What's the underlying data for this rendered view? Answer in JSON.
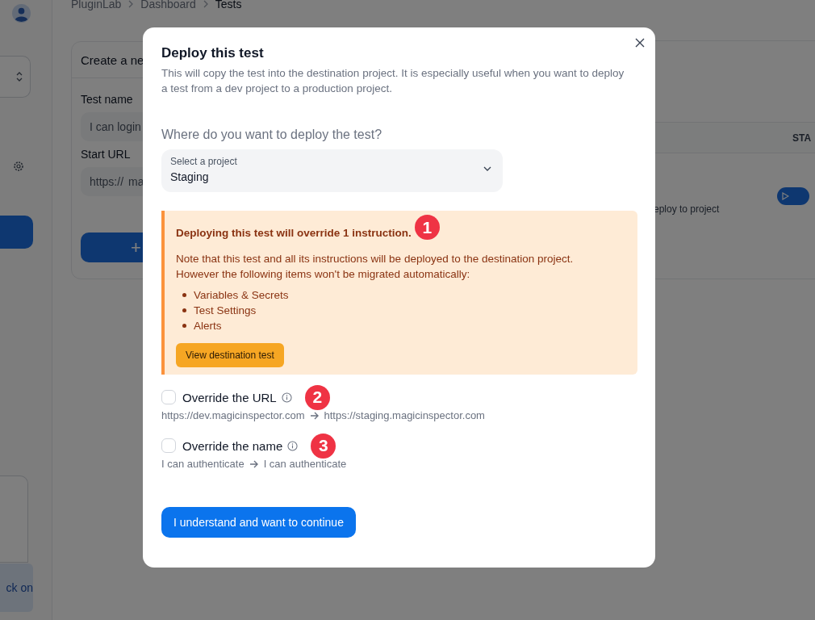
{
  "background": {
    "breadcrumb": [
      "PluginLab",
      "Dashboard",
      "Tests"
    ],
    "form_card": {
      "title": "Create a ne",
      "fields": [
        {
          "label": "Test name",
          "value": "I can login"
        },
        {
          "label": "Start URL",
          "prefix": "https://",
          "value": "ma"
        }
      ],
      "button": "+"
    },
    "table": {
      "column": "STA",
      "row_text": "eploy to project"
    },
    "sidebar_button": "ck on"
  },
  "dialog": {
    "title": "Deploy this test",
    "description": "This will copy the test into the destination project. It is especially useful when you want to deploy a test from a dev project to a production project.",
    "question": "Where do you want to deploy the test?",
    "select": {
      "label": "Select a project",
      "value": "Staging"
    },
    "alert": {
      "title": "Deploying this test will override 1 instruction.",
      "annotation": "1",
      "body": "Note that this test and all its instructions will be deployed to the destination project. However the following items won't be migrated automatically:",
      "items": [
        "Variables & Secrets",
        "Test Settings",
        "Alerts"
      ],
      "button": "View destination test"
    },
    "options": [
      {
        "label": "Override the URL",
        "checked": false,
        "annotation": "2",
        "from": "https://dev.magicinspector.com",
        "to": "https://staging.magicinspector.com"
      },
      {
        "label": "Override the name",
        "checked": false,
        "annotation": "3",
        "from": "I can authenticate",
        "to": "I can authenticate"
      }
    ],
    "confirm": "I understand and want to continue"
  }
}
